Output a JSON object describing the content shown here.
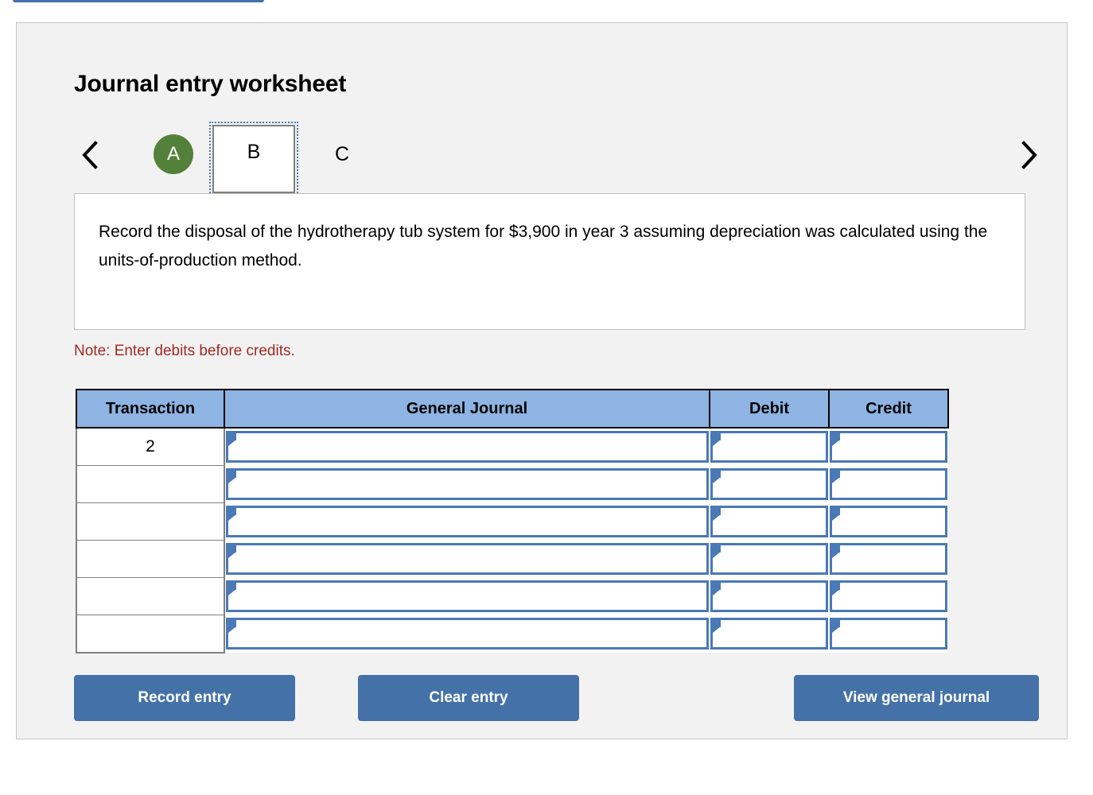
{
  "colors": {
    "panel_bg": "#F2F2F2",
    "panel_border": "#C6C6C6",
    "table_header_blue": "#8DB4E2",
    "input_border_blue": "#4A79B5",
    "button_blue": "#4472A8",
    "tab_active_green": "#548139",
    "note_red": "#A02B23",
    "focus_outline_blue": "#4A7EBB"
  },
  "header": {
    "title": "Journal entry worksheet"
  },
  "tabs": {
    "prev_icon": "chevron-left-icon",
    "next_icon": "chevron-right-icon",
    "items": [
      {
        "label": "A",
        "state": "completed"
      },
      {
        "label": "B",
        "state": "selected"
      },
      {
        "label": "C",
        "state": "pending"
      }
    ]
  },
  "description": {
    "text": "Record the disposal of the hydrotherapy tub system for $3,900 in year 3 assuming depreciation was calculated using the units-of-production method."
  },
  "note": {
    "text": "Note: Enter debits before credits."
  },
  "journal_table": {
    "columns": [
      {
        "key": "transaction",
        "label": "Transaction"
      },
      {
        "key": "general_journal",
        "label": "General Journal"
      },
      {
        "key": "debit",
        "label": "Debit"
      },
      {
        "key": "credit",
        "label": "Credit"
      }
    ],
    "rows": [
      {
        "transaction": "2",
        "general_journal": "",
        "debit": "",
        "credit": ""
      },
      {
        "transaction": "",
        "general_journal": "",
        "debit": "",
        "credit": ""
      },
      {
        "transaction": "",
        "general_journal": "",
        "debit": "",
        "credit": ""
      },
      {
        "transaction": "",
        "general_journal": "",
        "debit": "",
        "credit": ""
      },
      {
        "transaction": "",
        "general_journal": "",
        "debit": "",
        "credit": ""
      },
      {
        "transaction": "",
        "general_journal": "",
        "debit": "",
        "credit": ""
      }
    ]
  },
  "actions": {
    "record_entry": "Record entry",
    "clear_entry": "Clear entry",
    "view_general_journal": "View general journal"
  }
}
